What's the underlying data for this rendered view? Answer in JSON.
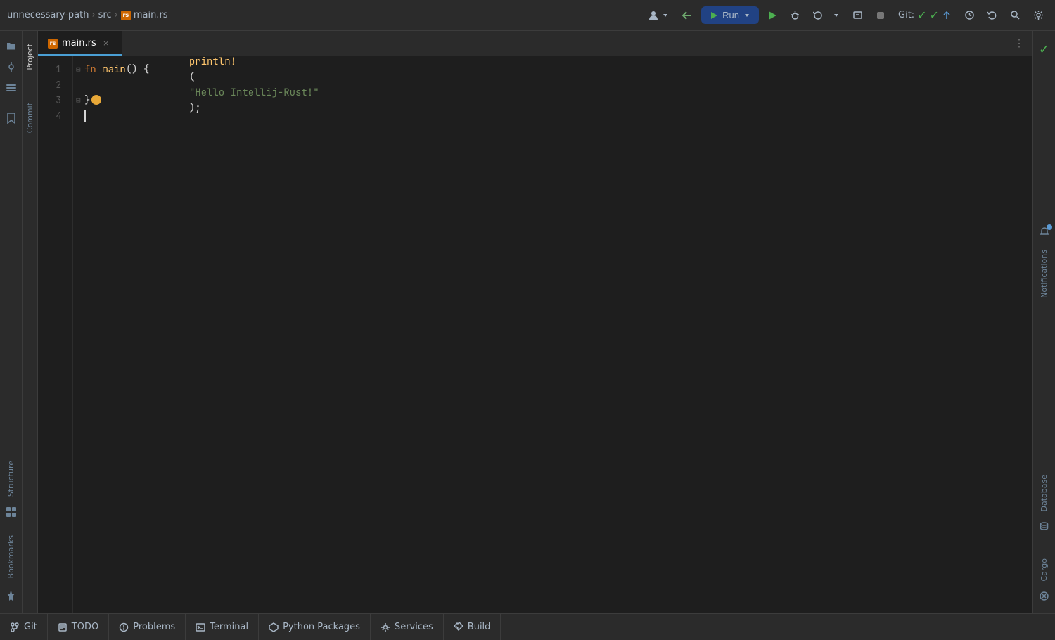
{
  "toolbar": {
    "breadcrumb": {
      "project": "unnecessary-path",
      "src": "src",
      "file": "main.rs"
    },
    "run_label": "Run",
    "git_label": "Git:",
    "buttons": [
      "←",
      "→",
      "▶",
      "⬛",
      "🔄",
      "↩",
      "🔍",
      "⚙"
    ]
  },
  "tabs": [
    {
      "label": "main.rs",
      "active": true,
      "icon": "rs"
    }
  ],
  "code": {
    "lines": [
      {
        "num": 1,
        "content_html": "<span class='kw'>fn</span> <span class='fn-name'>main</span><span class='punct'>() {</span>",
        "has_run": true,
        "has_fold": true
      },
      {
        "num": 2,
        "content_html": "    <span class='macro'>println!</span><span class='punct'>(</span><span class='string'>\"Hello Intellij-Rust!\"</span><span class='punct'>);</span>",
        "has_run": false,
        "has_fold": false
      },
      {
        "num": 3,
        "content_html": "<span class='brace-close'>}</span>",
        "has_run": false,
        "has_fold": true,
        "lightbulb": true
      },
      {
        "num": 4,
        "content_html": "",
        "cursor": true,
        "has_run": false,
        "has_fold": false
      }
    ]
  },
  "right_sidebar": {
    "labels": [
      "Database",
      "Cargo"
    ]
  },
  "left_sidebar": {
    "icons": [
      "📁",
      "✓",
      "🔖",
      "≡"
    ],
    "labels": [
      "Project",
      "Commit",
      "Bookmarks",
      "Structure"
    ]
  },
  "bottom_tabs": [
    {
      "icon": "⑂",
      "label": "Git"
    },
    {
      "icon": "≡",
      "label": "TODO"
    },
    {
      "icon": "⊙",
      "label": "Problems"
    },
    {
      "icon": "▭",
      "label": "Terminal"
    },
    {
      "icon": "⬡",
      "label": "Python Packages"
    },
    {
      "icon": "⚙",
      "label": "Services"
    },
    {
      "icon": "🔨",
      "label": "Build"
    }
  ]
}
